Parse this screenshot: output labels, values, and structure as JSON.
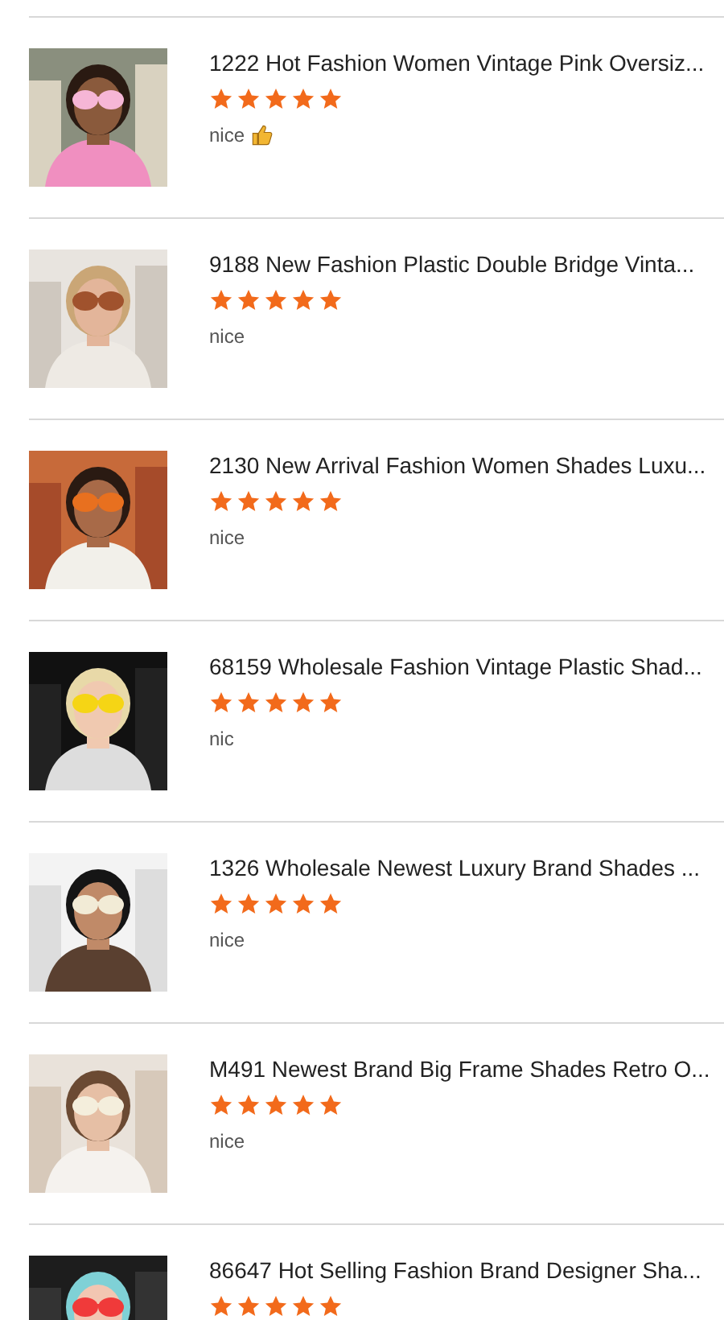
{
  "reviews": [
    {
      "title": "1222 Hot Fashion Women Vintage Pink Oversiz...",
      "stars": 5,
      "comment": "nice",
      "thumbs_up": true
    },
    {
      "title": "9188 New Fashion Plastic Double Bridge Vinta...",
      "stars": 5,
      "comment": "nice",
      "thumbs_up": false
    },
    {
      "title": "2130 New Arrival Fashion Women Shades Luxu...",
      "stars": 5,
      "comment": "nice",
      "thumbs_up": false
    },
    {
      "title": "68159 Wholesale Fashion Vintage Plastic Shad...",
      "stars": 5,
      "comment": "nic",
      "thumbs_up": false
    },
    {
      "title": "1326 Wholesale Newest Luxury Brand Shades ...",
      "stars": 5,
      "comment": "nice",
      "thumbs_up": false
    },
    {
      "title": "M491 Newest Brand Big Frame Shades Retro O...",
      "stars": 5,
      "comment": "nice",
      "thumbs_up": false
    },
    {
      "title": "86647 Hot Selling Fashion Brand Designer Sha...",
      "stars": 5
    }
  ]
}
